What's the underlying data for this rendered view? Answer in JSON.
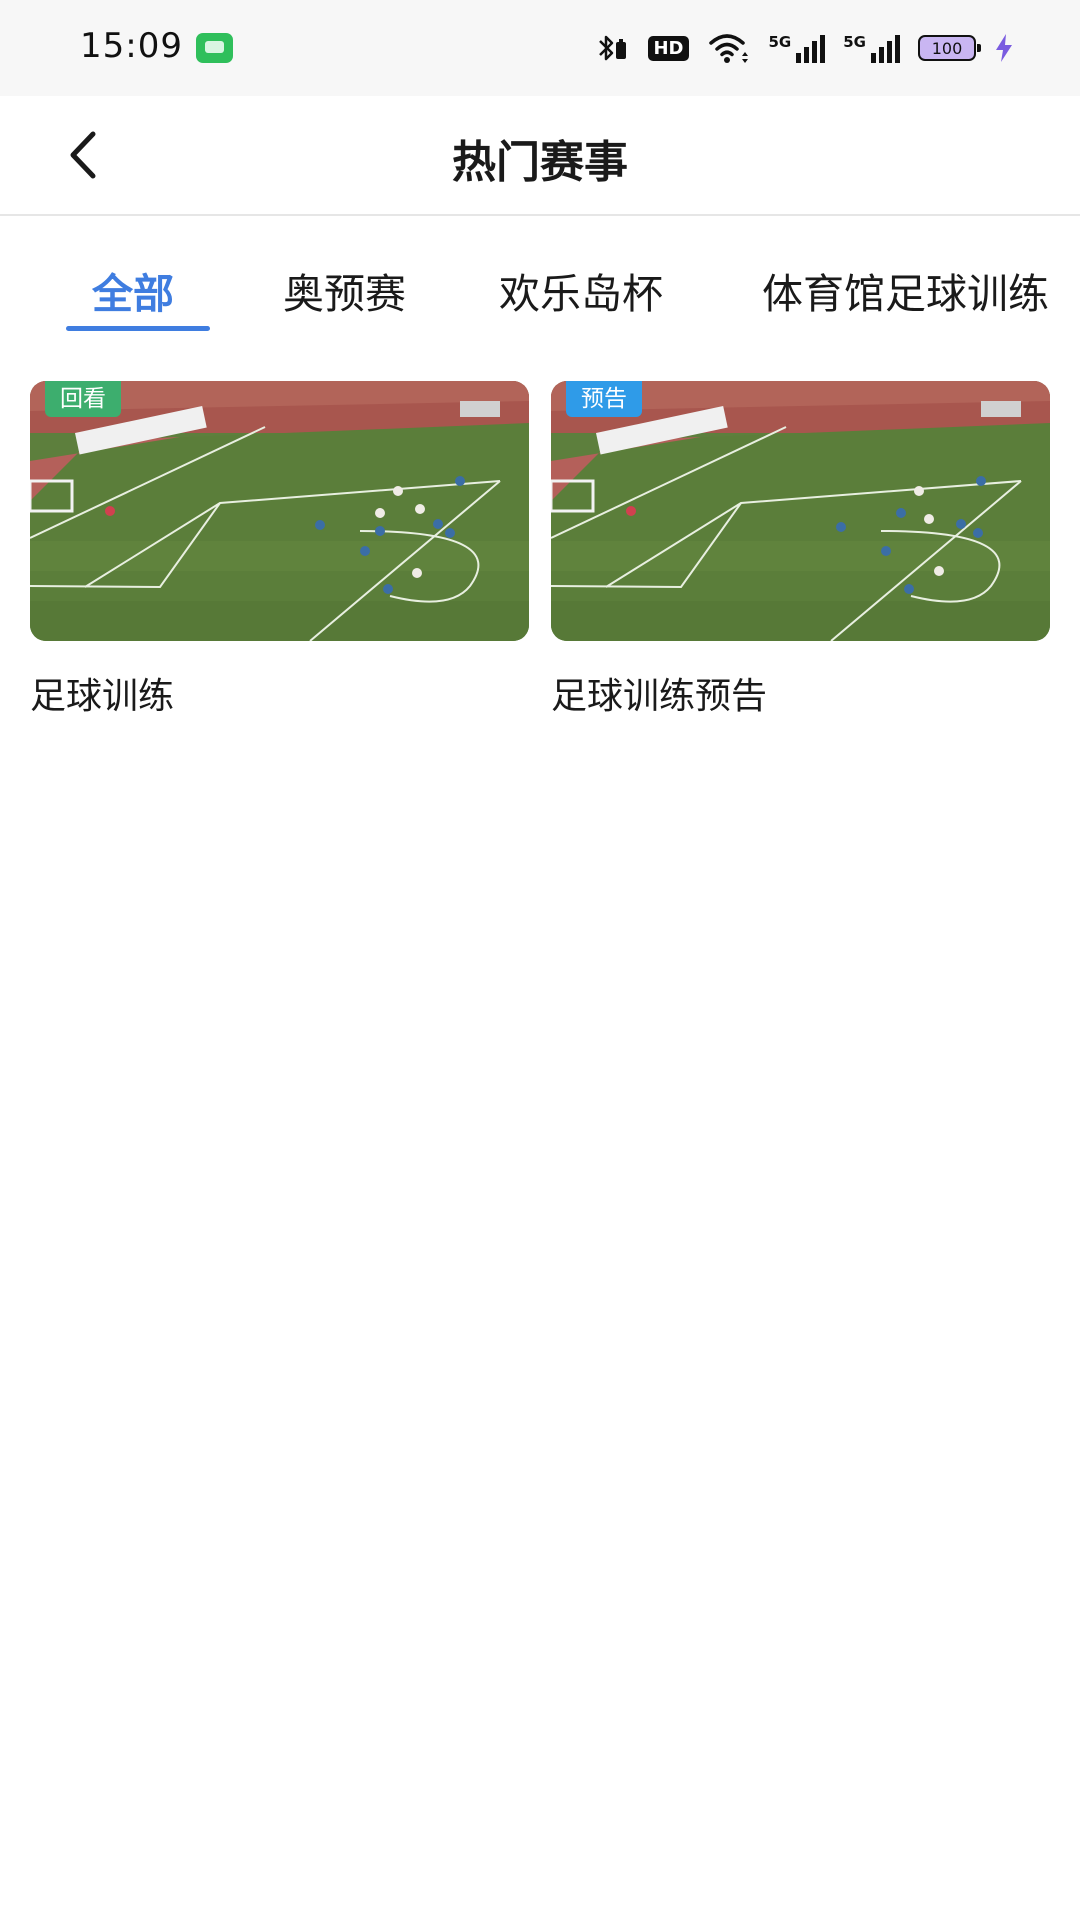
{
  "status_bar": {
    "time": "15:09",
    "hd_label": "HD",
    "network_1": "5G",
    "network_2": "5G",
    "battery": "100",
    "icons": [
      "message-icon",
      "bluetooth-icon",
      "wifi-icon",
      "signal-icon",
      "battery-icon",
      "charging-icon"
    ]
  },
  "header": {
    "title": "热门赛事",
    "back_icon": "chevron-left-icon"
  },
  "tabs": [
    {
      "label": "全部",
      "active": true
    },
    {
      "label": "奥预赛",
      "active": false
    },
    {
      "label": "欢乐岛杯",
      "active": false
    },
    {
      "label": "体育馆足球训练",
      "active": false
    }
  ],
  "cards": [
    {
      "badge": "回看",
      "badge_color": "#3dae6e",
      "title": "足球训练"
    },
    {
      "badge": "预告",
      "badge_color": "#2f9be8",
      "title": "足球训练预告"
    }
  ],
  "colors": {
    "accent": "#3f7de0",
    "replay_badge": "#3dae6e",
    "preview_badge": "#2f9be8",
    "battery_fill": "#c9b6f2",
    "charging": "#7a5ce0"
  }
}
